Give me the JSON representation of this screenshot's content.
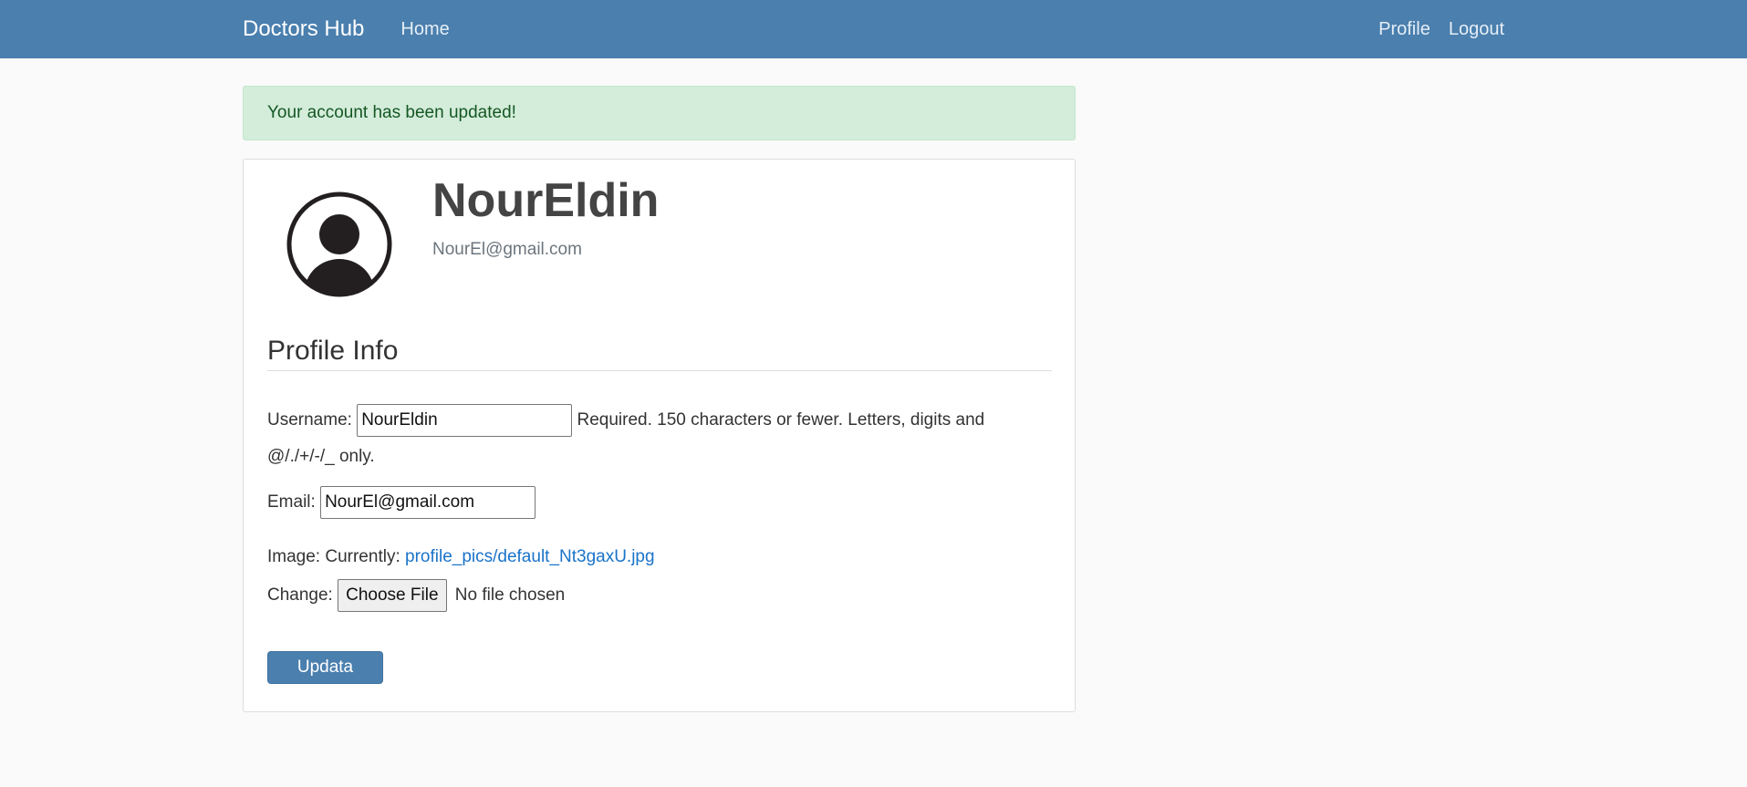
{
  "nav": {
    "brand": "Doctors Hub",
    "home": "Home",
    "profile": "Profile",
    "logout": "Logout"
  },
  "alert": {
    "message": "Your account has been updated!"
  },
  "profile": {
    "username": "NourEldin",
    "email": "NourEl@gmail.com",
    "avatar_icon": "user-circle-icon"
  },
  "form": {
    "section_title": "Profile Info",
    "username_label": "Username:",
    "username_value": "NourEldin",
    "username_help": "Required. 150 characters or fewer. Letters, digits and @/./+/-/_ only.",
    "email_label": "Email:",
    "email_value": "NourEl@gmail.com",
    "image_label": "Image: Currently:",
    "image_link": "profile_pics/default_Nt3gaxU.jpg",
    "change_label": "Change:",
    "choose_file_label": "Choose File",
    "no_file_text": "No file chosen",
    "submit_label": "Updata"
  },
  "colors": {
    "navbar": "#4a7fae",
    "alert_bg": "#d4edda",
    "alert_text": "#155724",
    "link": "#1a73c9"
  }
}
